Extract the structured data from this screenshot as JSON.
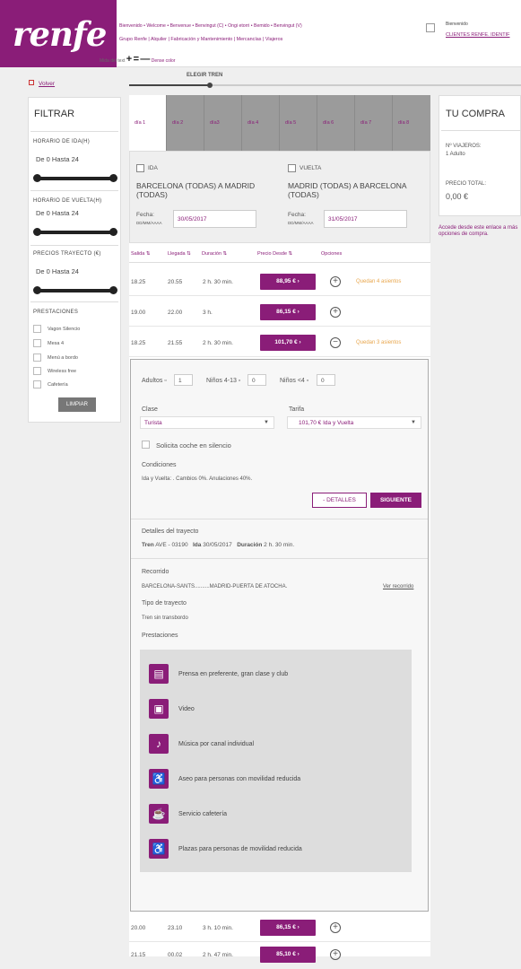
{
  "header": {
    "logo": "renfe",
    "greeting": "Bienvenido • Welcome • Benvenue • Benvingut (C) • Ongi etorri • Bemido • Benvingut (V)",
    "nav": "Grupo Renfe | Alquiler | Fabricación y Mantenimiento | Mercancías | Viajeros",
    "text_size_label": "Mida del text",
    "contrast_label": "Dense color",
    "bienvenido": "Bienvenido",
    "clientes_link": "CLIENTES RENFE. IDENTIF"
  },
  "nav": {
    "back": "Volver",
    "step_label": "ELEGIR TREN",
    "step_progress": 0.2
  },
  "filters": {
    "title": "FILTRAR",
    "ida_label": "HORARIO DE IDA(H)",
    "ida_value": "De 0 Hasta 24",
    "vuelta_label": "HORARIO DE VUELTA(H)",
    "vuelta_value": "De 0 Hasta 24",
    "precios_label": "PRECIOS TRAYECTO (€)",
    "precios_value": "De 0 Hasta 24",
    "prestaciones_label": "PRESTACIONES",
    "options": [
      "Vagon Silencio",
      "Mesa 4",
      "Menú a bordo",
      "Wireless free",
      "Cafetería"
    ],
    "clear_button": "LIMPIAR"
  },
  "days": [
    "día 1",
    "día 2",
    "día3",
    "día 4",
    "día 5",
    "día 6",
    "día 7",
    "día 8"
  ],
  "trip": {
    "ida_label": "IDA",
    "ida_route": "BARCELONA (TODAS) A MADRID (TODAS)",
    "vuelta_label": "VUELTA",
    "vuelta_route": "MADRID (TODAS) A BARCELONA (TODAS)",
    "fecha_label": "Fecha:",
    "fecha_format": "DD/MM/AAAA",
    "ida_date": "30/05/2017",
    "vuelta_date": "31/05/2017"
  },
  "table": {
    "headers": [
      "Salida ⇅",
      "Llegada ⇅",
      "Duración ⇅",
      "Precio Desde ⇅",
      "Opciones"
    ],
    "rows": [
      {
        "dep": "18.25",
        "arr": "20.55",
        "dur": "2 h. 30 min.",
        "price": "88,95 € ›",
        "opt": "+",
        "note": "Quedan 4 asientos"
      },
      {
        "dep": "19.00",
        "arr": "22.00",
        "dur": "3 h.",
        "price": "86,15 € ›",
        "opt": "+",
        "note": ""
      },
      {
        "dep": "18.25",
        "arr": "21.55",
        "dur": "2 h. 30 min.",
        "price": "101,70 € ›",
        "opt": "−",
        "note": "Quedan 3 asientos"
      }
    ],
    "bottom_rows": [
      {
        "dep": "20.00",
        "arr": "23.10",
        "dur": "3 h. 10 min.",
        "price": "86,15 € ›",
        "opt": "+"
      },
      {
        "dep": "21.15",
        "arr": "00.02",
        "dur": "2 h. 47 min.",
        "price": "85,10 € ›",
        "opt": "+"
      }
    ]
  },
  "details": {
    "adultos_label": "Adultos ▫",
    "adultos_value": "1",
    "ninos_label": "Niños 4-13 ▫",
    "ninos_value": "0",
    "ninos4_label": "Niños <4 ▫",
    "ninos4_value": "0",
    "clase_label": "Clase",
    "clase_value": "Turista",
    "tarifa_label": "Tarifa",
    "tarifa_value": "101,70 €  Ida y Vuelta",
    "silencio_label": "Solicita coche en silencio",
    "condiciones_label": "Condiciones",
    "condiciones_text": "Ida y Vuelta: .  Cambios 0%. Anulaciones 40%.",
    "detalles_button": "- DETALLES",
    "siguiente_button": "SIGUIENTE",
    "trayecto_label": "Detalles del trayecto",
    "tren_label": "Tren",
    "tren_value": "AVE - 03190",
    "ida_label": "Ida",
    "ida_value": "30/05/2017",
    "duracion_label": "Duración",
    "duracion_value": "2 h. 30 min.",
    "recorrido_label": "Recorrido",
    "recorrido_value": "BARCELONA-SANTS..........MADRID-PUERTA DE ATOCHA.",
    "ver_recorrido": "Ver recorrido",
    "tipo_label": "Tipo de trayecto",
    "tipo_value": "Tren sin transbordo",
    "prestaciones_label": "Prestaciones",
    "prestaciones": [
      {
        "icon": "newspaper-icon",
        "text": "Prensa en preferente, gran clase y club"
      },
      {
        "icon": "video-icon",
        "text": "Video"
      },
      {
        "icon": "music-icon",
        "text": "Música por canal individual"
      },
      {
        "icon": "accessible-toilet-icon",
        "text": "Aseo para personas con movilidad reducida"
      },
      {
        "icon": "cafeteria-icon",
        "text": "Servicio cafetería"
      },
      {
        "icon": "wheelchair-seat-icon",
        "text": "Plazas para personas de movilidad reducida"
      }
    ]
  },
  "purchase": {
    "title": "TU COMPRA",
    "viajeros_label": "Nº VIAJEROS:",
    "viajeros_value": "1 Adulto",
    "precio_label": "PRECIO TOTAL:",
    "precio_value": "0,00 €",
    "note": "Accede desde este enlace a más opciones de compra."
  },
  "colors": {
    "brand": "#8a1d78",
    "accent": "#e8a64d"
  }
}
